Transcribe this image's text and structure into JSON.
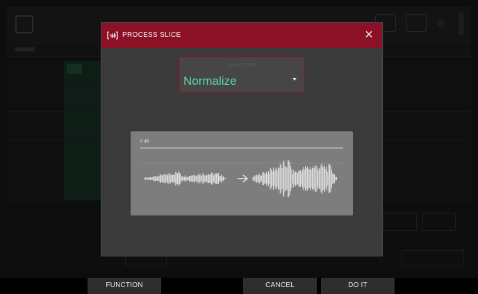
{
  "dialog": {
    "title": "PROCESS SLICE",
    "close_icon": "close-icon",
    "function_label": "FUNCTION",
    "function_value": "Normalize",
    "dropdown_icon": "triangle-down-icon",
    "preview_db_label": "0 dB",
    "arrow_icon": "arrow-right-icon"
  },
  "bottom_bar": {
    "function_label": "FUNCTION",
    "cancel_label": "CANCEL",
    "do_it_label": "DO IT"
  },
  "colors": {
    "header": "#8c1026",
    "accent_border": "#a11830",
    "function_value": "#5ed7a4",
    "dialog_bg": "#3a3a3a",
    "preview_bg": "#7d7d7d"
  }
}
